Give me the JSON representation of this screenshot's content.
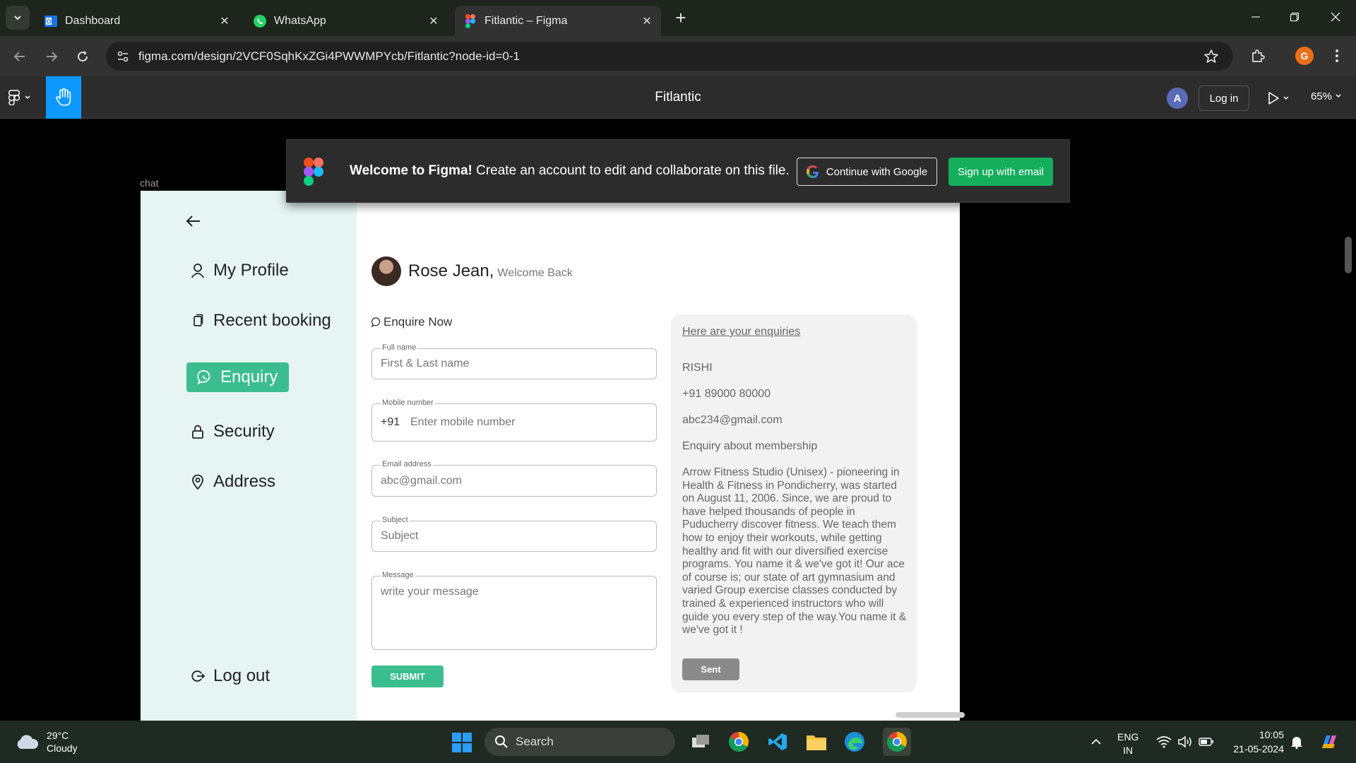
{
  "browser": {
    "tabs": [
      {
        "title": "Dashboard",
        "icon": "outlook-icon"
      },
      {
        "title": "WhatsApp",
        "icon": "whatsapp-icon"
      },
      {
        "title": "Fitlantic – Figma",
        "icon": "figma-icon",
        "active": true
      }
    ],
    "url": "figma.com/design/2VCF0SqhKxZGi4PWWMPYcb/Fitlantic?node-id=0-1",
    "profile_initial": "G"
  },
  "figma": {
    "file_title": "Fitlantic",
    "user_initial": "A",
    "login_label": "Log in",
    "zoom": "65%",
    "banner": {
      "bold": "Welcome to Figma!",
      "text": " Create an account to edit and collaborate on this file.",
      "google_label": "Continue with Google",
      "email_label": "Sign up with email"
    },
    "frame_label": "chat"
  },
  "app": {
    "sidebar": {
      "items": [
        {
          "label": "My  Profile",
          "icon": "user-icon"
        },
        {
          "label": "Recent booking",
          "icon": "clipboard-icon"
        },
        {
          "label": "Enquiry",
          "icon": "chat-icon",
          "active": true
        },
        {
          "label": "Security",
          "icon": "lock-icon"
        },
        {
          "label": "Address",
          "icon": "location-pin-icon"
        }
      ],
      "logout": "Log out"
    },
    "user": {
      "name": "Rose Jean,",
      "welcome": "Welcome Back"
    },
    "form": {
      "title": "Enquire Now",
      "fields": {
        "full_name": {
          "label": "Full name",
          "placeholder": "First & Last name"
        },
        "mobile": {
          "label": "Mobile number",
          "prefix": "+91",
          "placeholder": "Enter mobile number"
        },
        "email": {
          "label": "Email address",
          "placeholder": "abc@gmail.com"
        },
        "subject": {
          "label": "Subject",
          "placeholder": "Subject"
        },
        "message": {
          "label": "Message",
          "placeholder": "write your message"
        }
      },
      "submit": "SUBMIT"
    },
    "enquiries": {
      "header": "Here are your enquiries",
      "name": "RISHI",
      "phone": "+91 89000 80000",
      "email": "abc234@gmail.com",
      "subject": "Enquiry about membership",
      "message": "Arrow Fitness Studio (Unisex) - pioneering in Health & Fitness in Pondicherry, was started on August 11, 2006. Since, we are proud to have helped thousands of people in Puducherry discover fitness. We teach them how to enjoy their workouts, while getting healthy and fit with our diversified exercise programs. You name it & we've got it! Our ace of course is; our state of art gymnasium and varied Group exercise classes conducted by trained & experienced instructors who will guide you every step of the way.You name it & we've got it !",
      "status": "Sent"
    }
  },
  "taskbar": {
    "weather_temp": "29°C",
    "weather_desc": "Cloudy",
    "search": "Search",
    "lang1": "ENG",
    "lang2": "IN",
    "time": "10:05",
    "date": "21-05-2024"
  },
  "colors": {
    "accent_green": "#3bbd8f",
    "figma_blue": "#0d99ff",
    "signup_green": "#14ae5c",
    "sidebar_bg": "#e6f5f2"
  }
}
